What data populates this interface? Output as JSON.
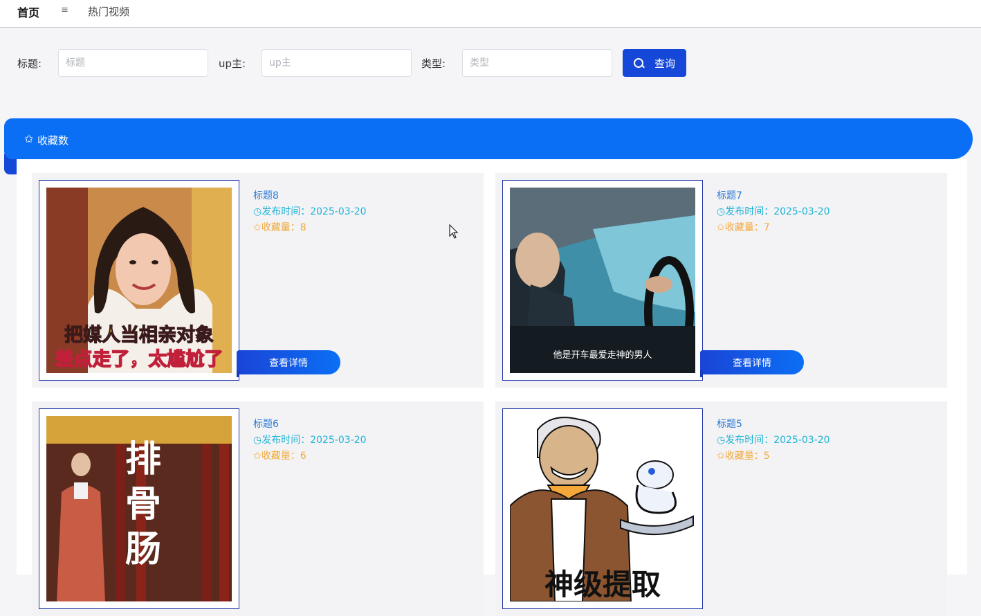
{
  "topbar": {
    "home": "首页",
    "menu_icon": "≡",
    "crumb": "热门视频"
  },
  "search": {
    "title_label": "标题:",
    "title_placeholder": "标题",
    "up_label": "up主:",
    "up_placeholder": "up主",
    "type_label": "类型:",
    "type_placeholder": "类型",
    "button_label": "查询"
  },
  "panel": {
    "star_icon": "✩",
    "title": "收藏数"
  },
  "cards": [
    {
      "title": "标题8",
      "date": "◷发布时间：2025-03-20",
      "favorites": "✩收藏量：8",
      "button": "查看详情",
      "caption1": "把媒人当相亲对象",
      "caption2": "差点走了，太尴尬了"
    },
    {
      "title": "标题7",
      "date": "◷发布时间：2025-03-20",
      "favorites": "✩收藏量：7",
      "button": "查看详情",
      "caption1": "他是开车最爱走神的男人"
    },
    {
      "title": "标题6",
      "date": "◷发布时间：2025-03-20",
      "favorites": "✩收藏量：6",
      "caption1": "排骨肠"
    },
    {
      "title": "标题5",
      "date": "◷发布时间：2025-03-20",
      "favorites": "✩收藏量：5",
      "caption1": "神级提取"
    }
  ]
}
